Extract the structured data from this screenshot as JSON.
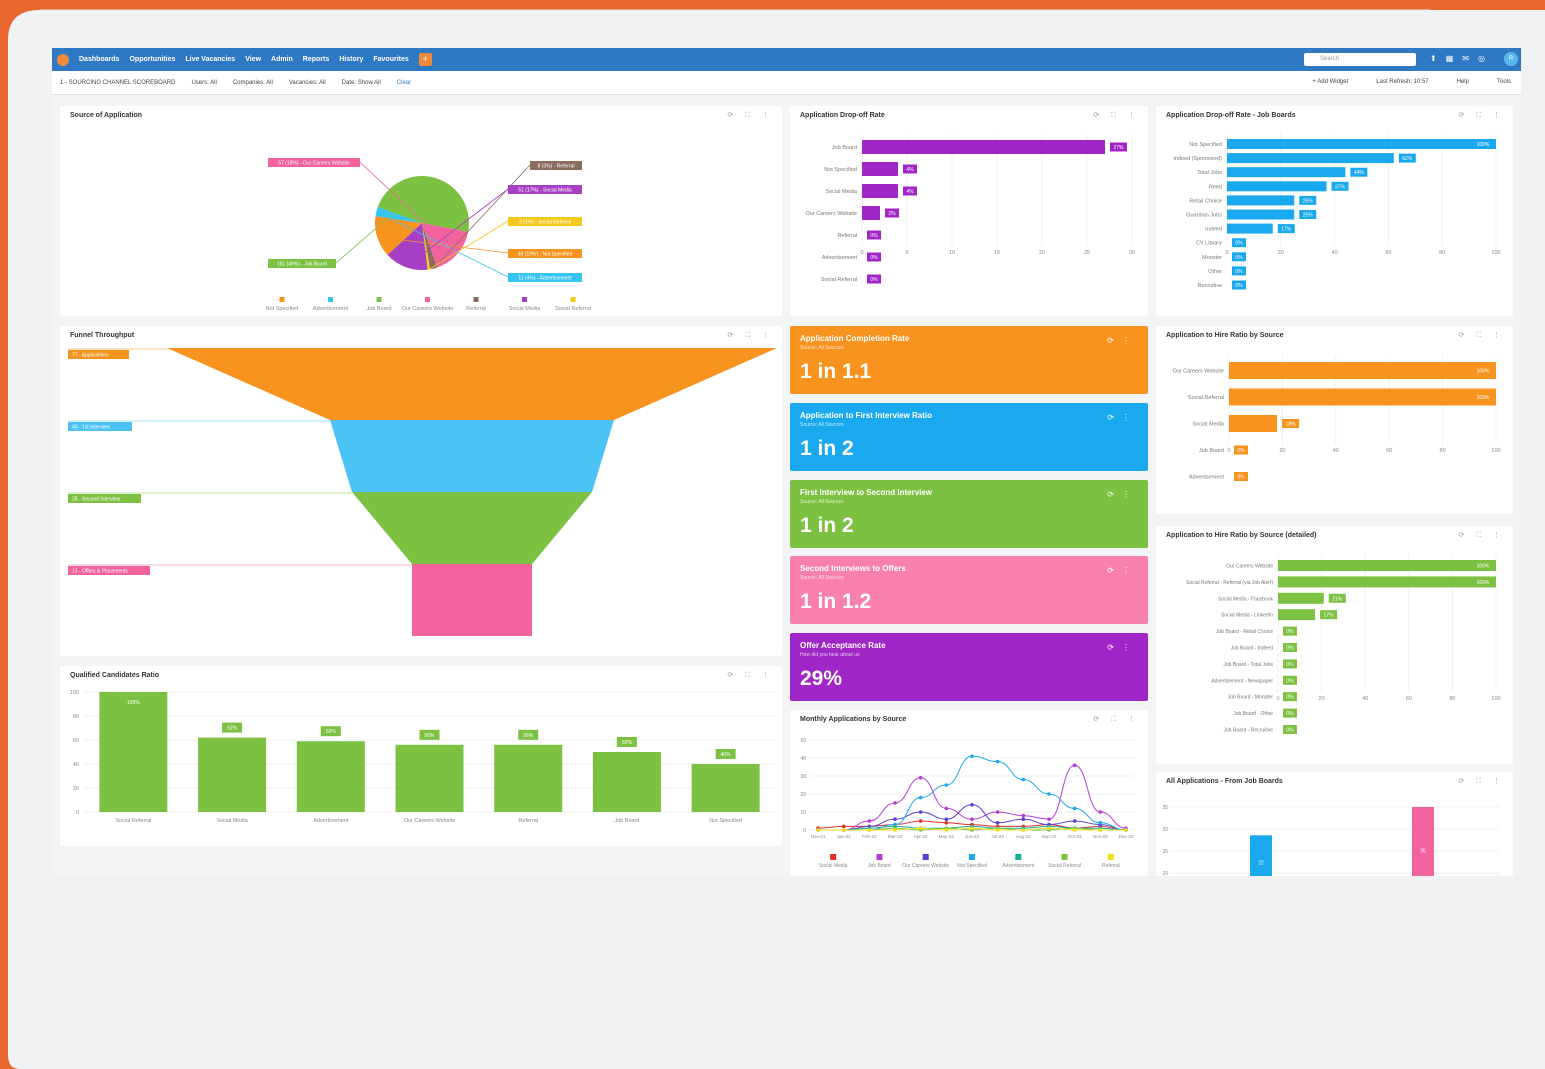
{
  "nav": {
    "items": [
      "Dashboards",
      "Opportunities",
      "Live Vacancies",
      "View",
      "Admin",
      "Reports",
      "History",
      "Favourites"
    ],
    "add_label": "+",
    "search_placeholder": "Search",
    "avatar_initials": "R"
  },
  "filters": {
    "dashboard_name": "1 - SOURCING CHANNEL SCOREBOARD",
    "users": "Users: All",
    "companies": "Companies: All",
    "vacancies": "Vacancies: All",
    "date": "Date: Show All",
    "clear": "Clear",
    "add_widget": "+ Add Widget",
    "last_refresh": "Last Refresh: 10:57",
    "help": "Help",
    "tools": "Tools"
  },
  "panels": {
    "source": "Source of Application",
    "dropoff": "Application Drop-off Rate",
    "dropoff_jb": "Application Drop-off Rate - Job Boards",
    "funnel": "Funnel Throughput",
    "hire_ratio": "Application to Hire Ratio by Source",
    "hire_ratio_detailed": "Application to Hire Ratio by Source (detailed)",
    "qualified": "Qualified Candidates Ratio",
    "monthly": "Monthly Applications by Source",
    "all_jb": "All Applications - From Job Boards"
  },
  "kpis": [
    {
      "title": "Application Completion Rate",
      "subtitle": "Source: All Sources",
      "value": "1 in 1.1",
      "color": "#f7931e"
    },
    {
      "title": "Application to First Interview Ratio",
      "subtitle": "Source: All Sources",
      "value": "1 in 2",
      "color": "#1aa9ef"
    },
    {
      "title": "First Interview to Second Interview",
      "subtitle": "Source: All Sources",
      "value": "1 in 2",
      "color": "#7dc142"
    },
    {
      "title": "Second Interviews to Offers",
      "subtitle": "Source: All Sources",
      "value": "1 in 1.2",
      "color": "#f780ad"
    },
    {
      "title": "Offer Acceptance Rate",
      "subtitle": "How did you hear about us",
      "value": "29%",
      "color": "#a126c7"
    }
  ],
  "chart_data": [
    {
      "type": "pie",
      "title": "Source of Application",
      "labels": [
        "Not Specified",
        "Advertisement",
        "Job Board",
        "Our Careers Website",
        "Referral",
        "Social Media",
        "Social Referral"
      ],
      "values": [
        48,
        11,
        161,
        57,
        8,
        51,
        3
      ],
      "slice_labels": [
        "48 (19%) - Not Specified",
        "11 (4%) - Advertisement",
        "161 (49%) - Job Board",
        "57 (18%) - Our Careers Website",
        "8 (3%) - Referral",
        "51 (17%) - Social Media",
        "3 (1%) - Social Referral"
      ],
      "colors": [
        "#f7931e",
        "#36c5f0",
        "#7dc142",
        "#f2639e",
        "#8b6b5e",
        "#a63fc4",
        "#f2c91d"
      ]
    },
    {
      "type": "bar",
      "orientation": "horizontal",
      "title": "Application Drop-off Rate",
      "categories": [
        "Job Board",
        "Not Specified",
        "Social Media",
        "Our Careers Website",
        "Referral",
        "Advertisement",
        "Social Referral"
      ],
      "values": [
        27,
        4,
        4,
        2,
        0,
        0,
        0
      ],
      "labels": [
        "27%",
        "4%",
        "4%",
        "2%",
        "0%",
        "0%",
        "0%"
      ],
      "xlim": [
        0,
        30
      ],
      "ticks": [
        "0",
        "5",
        "10",
        "15",
        "20",
        "25",
        "30"
      ],
      "color": "#a126c7"
    },
    {
      "type": "bar",
      "orientation": "horizontal",
      "title": "Application Drop-off Rate - Job Boards",
      "categories": [
        "Not Specified",
        "Indeed (Sponsored)",
        "Total Jobs",
        "Reed",
        "Retail Choice",
        "Guardian Jobs",
        "Indeed",
        "CV Library",
        "Monster",
        "Other",
        "Recruitive"
      ],
      "values": [
        100,
        62,
        44,
        37,
        25,
        25,
        17,
        0,
        0,
        0,
        0
      ],
      "labels": [
        "100%",
        "62%",
        "44%",
        "37%",
        "25%",
        "25%",
        "17%",
        "0%",
        "0%",
        "0%",
        "0%"
      ],
      "xlim": [
        0,
        100
      ],
      "ticks": [
        "0",
        "20",
        "40",
        "60",
        "80",
        "100"
      ],
      "color": "#1aa9ef"
    },
    {
      "type": "bar",
      "orientation": "horizontal",
      "title": "Funnel Throughput",
      "categories": [
        "Applications",
        "1st Interview",
        "Second Interview",
        "Offers & Placements"
      ],
      "values": [
        77,
        40,
        28,
        13
      ],
      "labels": [
        "77 - Applications",
        "40 - 1st Interview",
        "28 - Second Interview",
        "13 - Offers & Placements"
      ],
      "colors": [
        "#f7931e",
        "#4cc3f5",
        "#7dc142",
        "#f2639e"
      ]
    },
    {
      "type": "bar",
      "orientation": "horizontal",
      "title": "Application to Hire Ratio by Source",
      "categories": [
        "Our Careers Website",
        "Social Referral",
        "Social Media",
        "Job Board",
        "Advertisement"
      ],
      "values": [
        100,
        100,
        18,
        0,
        0
      ],
      "labels": [
        "100%",
        "100%",
        "18%",
        "0%",
        "0%"
      ],
      "xlim": [
        0,
        100
      ],
      "ticks": [
        "0",
        "20",
        "40",
        "60",
        "80",
        "100"
      ],
      "color": "#f7931e"
    },
    {
      "type": "bar",
      "orientation": "horizontal",
      "title": "Application to Hire Ratio by Source (detailed)",
      "categories": [
        "Our Careers Website",
        "Social Referral - Referral (via Job Alert)",
        "Social Media - Facebook",
        "Social Media - LinkedIn",
        "Job Board - Retail Choice",
        "Job Board - Indeed",
        "Job Board - Total Jobs",
        "Advertisement - Newspaper",
        "Job Board - Monster",
        "Job Board - Other",
        "Job Board - Recruitive"
      ],
      "values": [
        100,
        100,
        21,
        17,
        0,
        0,
        0,
        0,
        0,
        0,
        0
      ],
      "labels": [
        "100%",
        "100%",
        "21%",
        "17%",
        "0%",
        "0%",
        "0%",
        "0%",
        "0%",
        "0%",
        "0%"
      ],
      "xlim": [
        0,
        100
      ],
      "ticks": [
        "0",
        "20",
        "40",
        "60",
        "80",
        "100"
      ],
      "color": "#7dc142"
    },
    {
      "type": "bar",
      "title": "Qualified Candidates Ratio",
      "categories": [
        "Social Referral",
        "Social Media",
        "Advertisement",
        "Our Careers Website",
        "Referral",
        "Job Board",
        "Not Specified"
      ],
      "values": [
        100,
        62,
        59,
        56,
        56,
        50,
        40
      ],
      "labels": [
        "100%",
        "62%",
        "59%",
        "56%",
        "56%",
        "50%",
        "40%"
      ],
      "ylim": [
        0,
        100
      ],
      "ticks": [
        "0",
        "20",
        "40",
        "60",
        "80",
        "100"
      ],
      "color": "#7dc142"
    },
    {
      "type": "line",
      "title": "Monthly Applications by Source",
      "x": [
        "Nov-21",
        "Jan-22",
        "Feb-22",
        "Mar-22",
        "Apr-22",
        "May-22",
        "Jun-22",
        "Jul-22",
        "Aug-22",
        "Sep-22",
        "Oct-22",
        "Nov-22",
        "Dec-22"
      ],
      "ylim": [
        0,
        50
      ],
      "ticks": [
        "0",
        "10",
        "20",
        "30",
        "40",
        "50"
      ],
      "series": [
        {
          "name": "Social Media",
          "color": "#e62d2d",
          "values": [
            1,
            2,
            2,
            3,
            5,
            4,
            3,
            2,
            2,
            3,
            1,
            2,
            0
          ]
        },
        {
          "name": "Job Board",
          "color": "#b53dd6",
          "values": [
            0,
            0,
            5,
            15,
            29,
            12,
            6,
            10,
            8,
            6,
            36,
            10,
            1
          ]
        },
        {
          "name": "Our Careers Website",
          "color": "#5b3fd1",
          "values": [
            0,
            0,
            2,
            6,
            10,
            6,
            14,
            4,
            6,
            3,
            5,
            3,
            0
          ]
        },
        {
          "name": "Not Specified",
          "color": "#1aa9ef",
          "values": [
            0,
            0,
            0,
            3,
            18,
            25,
            41,
            38,
            28,
            20,
            12,
            4,
            0
          ]
        },
        {
          "name": "Advertisement",
          "color": "#17b19a",
          "values": [
            0,
            0,
            1,
            2,
            1,
            1,
            2,
            1,
            1,
            2,
            1,
            1,
            0
          ]
        },
        {
          "name": "Social Referral",
          "color": "#7dc142",
          "values": [
            0,
            0,
            0,
            1,
            0,
            1,
            0,
            1,
            0,
            0,
            1,
            0,
            0
          ]
        },
        {
          "name": "Referral",
          "color": "#f2de1d",
          "values": [
            0,
            0,
            0,
            0,
            1,
            0,
            1,
            0,
            0,
            1,
            0,
            0,
            0
          ]
        }
      ]
    },
    {
      "type": "bar",
      "title": "All Applications - From Job Boards",
      "ticks": [
        "35",
        "30",
        "25",
        "20"
      ],
      "values": [
        20,
        35
      ],
      "labels": [
        "22",
        "35"
      ],
      "colors": [
        "#1aa9ef",
        "#f2639e"
      ]
    }
  ]
}
